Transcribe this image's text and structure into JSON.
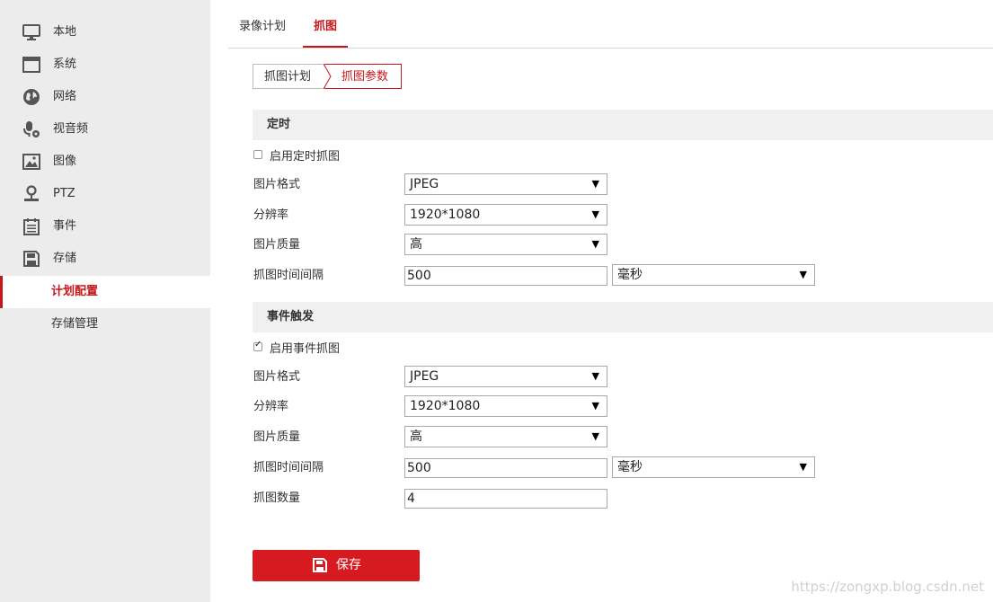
{
  "sidebar": {
    "items": [
      {
        "label": "本地",
        "icon": "monitor-icon"
      },
      {
        "label": "系统",
        "icon": "window-icon"
      },
      {
        "label": "网络",
        "icon": "globe-icon"
      },
      {
        "label": "视音频",
        "icon": "microphone-icon"
      },
      {
        "label": "图像",
        "icon": "image-icon"
      },
      {
        "label": "PTZ",
        "icon": "ptz-icon"
      },
      {
        "label": "事件",
        "icon": "calendar-icon"
      },
      {
        "label": "存储",
        "icon": "disk-icon"
      }
    ],
    "subitems": [
      {
        "label": "计划配置",
        "active": true
      },
      {
        "label": "存储管理",
        "active": false
      }
    ]
  },
  "tabs": {
    "record_plan": "录像计划",
    "capture": "抓图"
  },
  "subtabs": {
    "capture_plan": "抓图计划",
    "capture_params": "抓图参数"
  },
  "timed": {
    "title": "定时",
    "enable_label": "启用定时抓图",
    "enabled": false,
    "format_label": "图片格式",
    "format_value": "JPEG",
    "resolution_label": "分辨率",
    "resolution_value": "1920*1080",
    "quality_label": "图片质量",
    "quality_value": "高",
    "interval_label": "抓图时间间隔",
    "interval_value": "500",
    "unit_value": "毫秒"
  },
  "event": {
    "title": "事件触发",
    "enable_label": "启用事件抓图",
    "enabled": true,
    "format_label": "图片格式",
    "format_value": "JPEG",
    "resolution_label": "分辨率",
    "resolution_value": "1920*1080",
    "quality_label": "图片质量",
    "quality_value": "高",
    "interval_label": "抓图时间间隔",
    "interval_value": "500",
    "unit_value": "毫秒",
    "count_label": "抓图数量",
    "count_value": "4"
  },
  "save_label": "保存",
  "watermark": "https://zongxp.blog.csdn.net",
  "colors": {
    "accent": "#c8161d",
    "button": "#d71920",
    "sidebar_bg": "#ececec"
  }
}
